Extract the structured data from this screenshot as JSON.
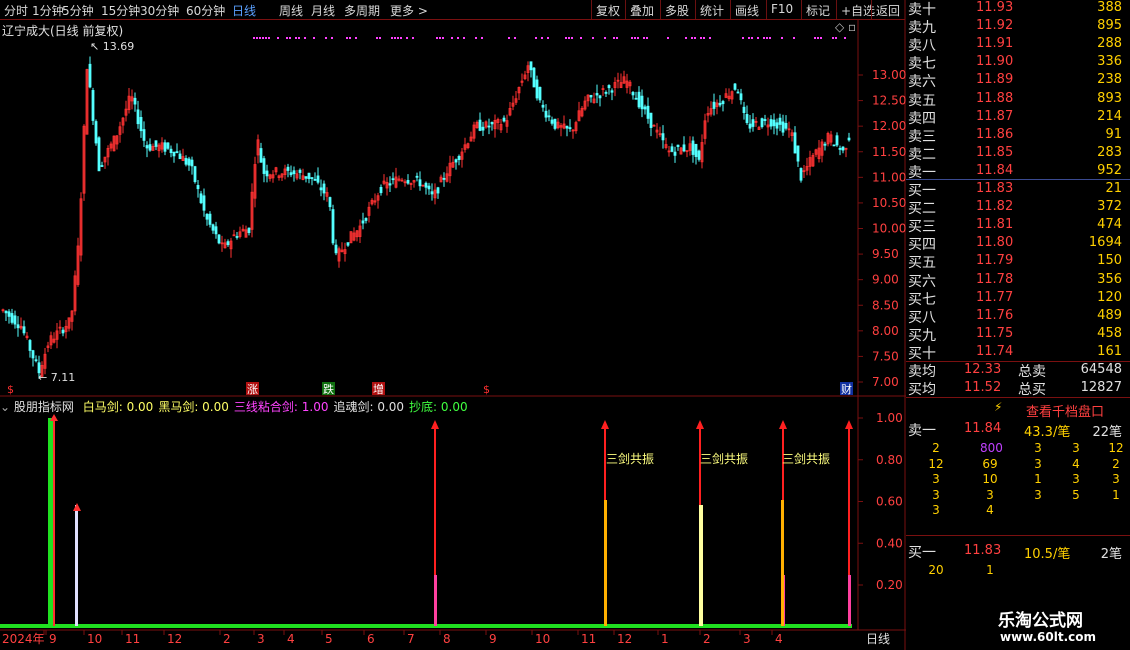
{
  "toolbar": {
    "items": [
      "分时",
      "1分钟",
      "5分钟",
      "15分钟",
      "30分钟",
      "60分钟",
      "日线",
      "周线",
      "月线",
      "多周期",
      "更多 >"
    ],
    "active": "日线",
    "right_items": [
      "复权",
      "叠加",
      "多股",
      "统计",
      "画线",
      "F10",
      "标记",
      "+自选",
      "返回"
    ]
  },
  "chart": {
    "title": "辽宁成大(日线 前复权)",
    "high_label": "13.69",
    "low_label": "7.11",
    "y_ticks": [
      "13.00",
      "12.50",
      "12.00",
      "11.50",
      "11.00",
      "10.50",
      "10.00",
      "9.50",
      "9.00",
      "8.50",
      "8.00",
      "7.50",
      "7.00"
    ],
    "event_markers": [
      {
        "text": "$",
        "color": "#ff3030",
        "bg": "#000"
      },
      {
        "text": "涨",
        "color": "#ffffff",
        "bg": "#b01010"
      },
      {
        "text": "跌",
        "color": "#ffffff",
        "bg": "#107010"
      },
      {
        "text": "增",
        "color": "#ffffff",
        "bg": "#b01010"
      },
      {
        "text": "$",
        "color": "#ff3030",
        "bg": "#000"
      },
      {
        "text": "财",
        "color": "#ffffff",
        "bg": "#1030a0"
      }
    ]
  },
  "indicator": {
    "name": "股朋指标网",
    "items": [
      {
        "label": "白马剑:",
        "value": "0.00",
        "color": "#ffff66"
      },
      {
        "label": "黑马剑:",
        "value": "0.00",
        "color": "#ffff66"
      },
      {
        "label": "三线粘合剑:",
        "value": "1.00",
        "color": "#ff44ff"
      },
      {
        "label": "追魂剑:",
        "value": "0.00",
        "color": "#e0e0e0"
      },
      {
        "label": "抄底:",
        "value": "0.00",
        "color": "#40ff40"
      }
    ],
    "y_ticks": [
      "1.00",
      "0.80",
      "0.60",
      "0.40",
      "0.20"
    ],
    "signal_text": "三剑共振",
    "signal_count": 3
  },
  "xaxis": {
    "labels": [
      "2024年",
      "9",
      "10",
      "11",
      "12",
      "2",
      "3",
      "4",
      "5",
      "6",
      "7",
      "8",
      "9",
      "10",
      "11",
      "12",
      "1",
      "2",
      "3",
      "4"
    ],
    "period": "日线"
  },
  "orderbook": {
    "asks": [
      {
        "label": "卖十",
        "price": "11.93",
        "vol": "388"
      },
      {
        "label": "卖九",
        "price": "11.92",
        "vol": "895"
      },
      {
        "label": "卖八",
        "price": "11.91",
        "vol": "288"
      },
      {
        "label": "卖七",
        "price": "11.90",
        "vol": "336"
      },
      {
        "label": "卖六",
        "price": "11.89",
        "vol": "238"
      },
      {
        "label": "卖五",
        "price": "11.88",
        "vol": "893"
      },
      {
        "label": "卖四",
        "price": "11.87",
        "vol": "214"
      },
      {
        "label": "卖三",
        "price": "11.86",
        "vol": "91"
      },
      {
        "label": "卖二",
        "price": "11.85",
        "vol": "283"
      },
      {
        "label": "卖一",
        "price": "11.84",
        "vol": "952"
      }
    ],
    "bids": [
      {
        "label": "买一",
        "price": "11.83",
        "vol": "21"
      },
      {
        "label": "买二",
        "price": "11.82",
        "vol": "372"
      },
      {
        "label": "买三",
        "price": "11.81",
        "vol": "474"
      },
      {
        "label": "买四",
        "price": "11.80",
        "vol": "1694"
      },
      {
        "label": "买五",
        "price": "11.79",
        "vol": "150"
      },
      {
        "label": "买六",
        "price": "11.78",
        "vol": "356"
      },
      {
        "label": "买七",
        "price": "11.77",
        "vol": "120"
      },
      {
        "label": "买八",
        "price": "11.76",
        "vol": "489"
      },
      {
        "label": "买九",
        "price": "11.75",
        "vol": "458"
      },
      {
        "label": "买十",
        "price": "11.74",
        "vol": "161"
      }
    ],
    "summary": [
      {
        "label": "卖均",
        "price": "12.33",
        "tlabel": "总卖",
        "vol": "64548"
      },
      {
        "label": "买均",
        "price": "11.52",
        "tlabel": "总买",
        "vol": "12827"
      }
    ],
    "depth_title": "查看千档盘口",
    "sell1": {
      "label": "卖一",
      "price": "11.84",
      "per": "43.3/笔",
      "count": "22笔"
    },
    "sell1_grid": [
      [
        "2",
        "800",
        "3",
        "3",
        "12"
      ],
      [
        "12",
        "69",
        "3",
        "4",
        "2"
      ],
      [
        "3",
        "10",
        "1",
        "3",
        "3"
      ],
      [
        "3",
        "3",
        "3",
        "5",
        "1"
      ],
      [
        "3",
        "4"
      ]
    ],
    "buy1": {
      "label": "买一",
      "price": "11.83",
      "per": "10.5/笔",
      "count": "2笔"
    },
    "buy1_grid": [
      [
        "20",
        "1"
      ]
    ]
  },
  "watermark": {
    "title": "乐淘公式网",
    "url": "www.60lt.com"
  },
  "colors": {
    "up": "#ff3232",
    "down": "#54ffff",
    "grid": "#7a1010",
    "accent": "#5aa0ff"
  }
}
